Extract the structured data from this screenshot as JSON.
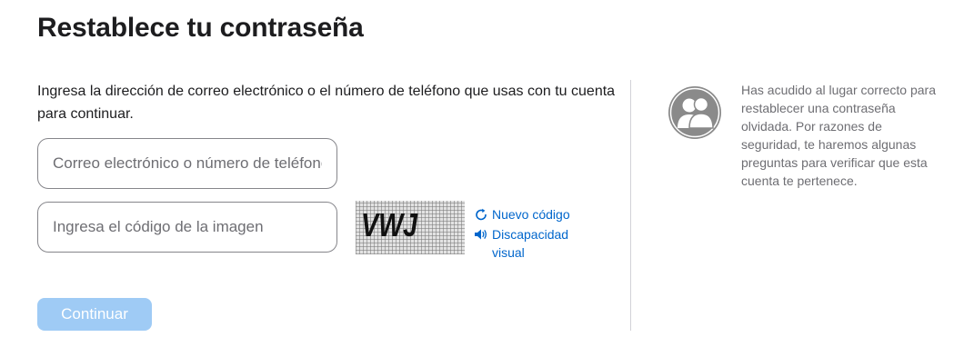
{
  "page": {
    "title": "Restablece tu contraseña",
    "intro": "Ingresa la dirección de correo electrónico o el número de teléfono que usas con tu cuenta para continuar."
  },
  "form": {
    "email_placeholder": "Correo electrónico o número de teléfono",
    "email_value": "",
    "captcha_placeholder": "Ingresa el código de la imagen",
    "captcha_value": "",
    "captcha_image_text": "VWJ",
    "new_code_label": "Nuevo código",
    "new_code_icon": "refresh-icon",
    "accessibility_label": "Discapacidad visual",
    "accessibility_icon": "speaker-icon",
    "continue_label": "Continuar"
  },
  "side_info": {
    "icon": "two-people-icon",
    "text": "Has acudido al lugar correcto para restablecer una contraseña olvidada. Por razones de seguridad, te haremos algunas preguntas para verificar que esta cuenta te pertenece."
  },
  "colors": {
    "text_primary": "#1d1d1f",
    "text_secondary": "#6e6e73",
    "link": "#0066cc",
    "button_disabled": "#9fcbf5",
    "border": "#86868b",
    "divider": "#d2d2d7"
  }
}
